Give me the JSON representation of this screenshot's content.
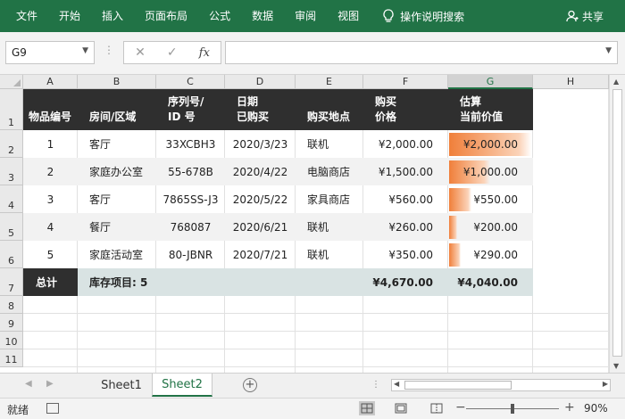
{
  "ribbon": {
    "tabs": [
      "文件",
      "开始",
      "插入",
      "页面布局",
      "公式",
      "数据",
      "审阅",
      "视图"
    ],
    "tell_me": "操作说明搜索",
    "share": "共享"
  },
  "formula_bar": {
    "name_box": "G9",
    "cancel": "✕",
    "enter": "✓",
    "fx": "fx",
    "value": ""
  },
  "columns": [
    "A",
    "B",
    "C",
    "D",
    "E",
    "F",
    "G",
    "H"
  ],
  "selected_column": "G",
  "rows": [
    "1",
    "2",
    "3",
    "4",
    "5",
    "6",
    "7",
    "8",
    "9",
    "10",
    "11"
  ],
  "table": {
    "headers": [
      "物品编号",
      "房间/区域",
      "序列号/\nID 号",
      "日期\n已购买",
      "购买地点",
      "购买\n价格",
      "估算\n当前价值"
    ],
    "rows": [
      {
        "id": "1",
        "room": "客厅",
        "serial": "33XCBH3",
        "date": "2020/3/23",
        "place": "联机",
        "price": "¥2,000.00",
        "value": "¥2,000.00",
        "value_ratio": 1.0
      },
      {
        "id": "2",
        "room": "家庭办公室",
        "serial": "55-678B",
        "date": "2020/4/22",
        "place": "电脑商店",
        "price": "¥1,500.00",
        "value": "¥1,000.00",
        "value_ratio": 0.5
      },
      {
        "id": "3",
        "room": "客厅",
        "serial": "7865SS-J3",
        "date": "2020/5/22",
        "place": "家具商店",
        "price": "¥560.00",
        "value": "¥550.00",
        "value_ratio": 0.275
      },
      {
        "id": "4",
        "room": "餐厅",
        "serial": "768087",
        "date": "2020/6/21",
        "place": "联机",
        "price": "¥260.00",
        "value": "¥200.00",
        "value_ratio": 0.1
      },
      {
        "id": "5",
        "room": "家庭活动室",
        "serial": "80-JBNR",
        "date": "2020/7/21",
        "place": "联机",
        "price": "¥350.00",
        "value": "¥290.00",
        "value_ratio": 0.145
      }
    ],
    "total": {
      "label": "总计",
      "count_label": "库存项目: 5",
      "price": "¥4,670.00",
      "value": "¥4,040.00"
    }
  },
  "sheets": [
    {
      "name": "Sheet1",
      "active": false
    },
    {
      "name": "Sheet2",
      "active": true
    }
  ],
  "status": {
    "ready": "就绪",
    "zoom": "90%"
  },
  "colors": {
    "accent": "#217346",
    "header_band": "#2f2f2f",
    "total_band": "#d9e3e3",
    "databar": "#f07f3a"
  }
}
